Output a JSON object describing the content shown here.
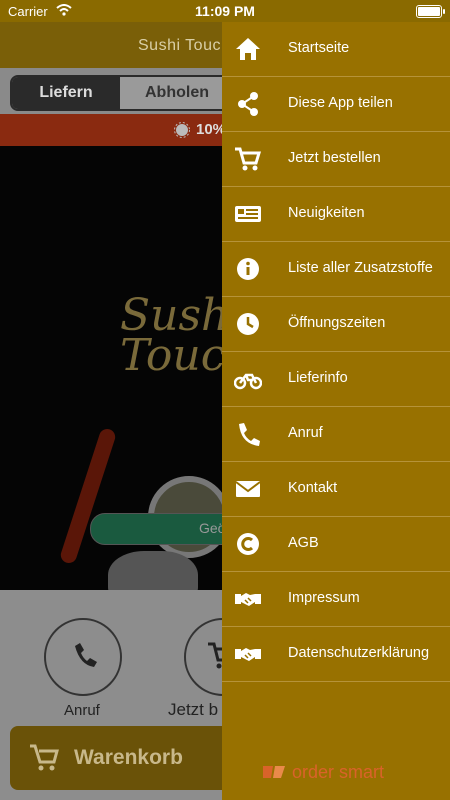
{
  "status_bar": {
    "carrier": "Carrier",
    "time": "11:09 PM"
  },
  "app": {
    "title": "Sushi Touch",
    "order_mode": {
      "delivery_label": "Liefern",
      "pickup_label": "Abholen"
    },
    "promo_text": "10%",
    "hero": {
      "logo_text": "Sushi Touch",
      "status_pill": "Geö"
    },
    "actions": [
      {
        "label": "Anruf",
        "icon": "phone-icon"
      },
      {
        "label": "Jetzt b",
        "icon": "cart-icon"
      }
    ],
    "cart_button": {
      "label": "Warenkorb",
      "icon": "cart-icon"
    }
  },
  "drawer": {
    "items": [
      {
        "label": "Startseite",
        "icon": "home-icon"
      },
      {
        "label": "Diese App teilen",
        "icon": "share-icon"
      },
      {
        "label": "Jetzt bestellen",
        "icon": "cart-icon"
      },
      {
        "label": "Neuigkeiten",
        "icon": "news-icon"
      },
      {
        "label": "Liste aller Zusatzstoffe",
        "icon": "info-icon"
      },
      {
        "label": "Öffnungszeiten",
        "icon": "clock-icon"
      },
      {
        "label": "Lieferinfo",
        "icon": "motorbike-icon"
      },
      {
        "label": "Anruf",
        "icon": "phone-icon"
      },
      {
        "label": "Kontakt",
        "icon": "envelope-icon"
      },
      {
        "label": "AGB",
        "icon": "copyright-icon"
      },
      {
        "label": "Impressum",
        "icon": "handshake-icon"
      },
      {
        "label": "Datenschutzerklärung",
        "icon": "handshake-icon"
      }
    ],
    "brand": "order smart"
  },
  "colors": {
    "drawer_bg": "#987100",
    "drawer_divider": "#b69339",
    "brand_orange": "#d9632a"
  }
}
